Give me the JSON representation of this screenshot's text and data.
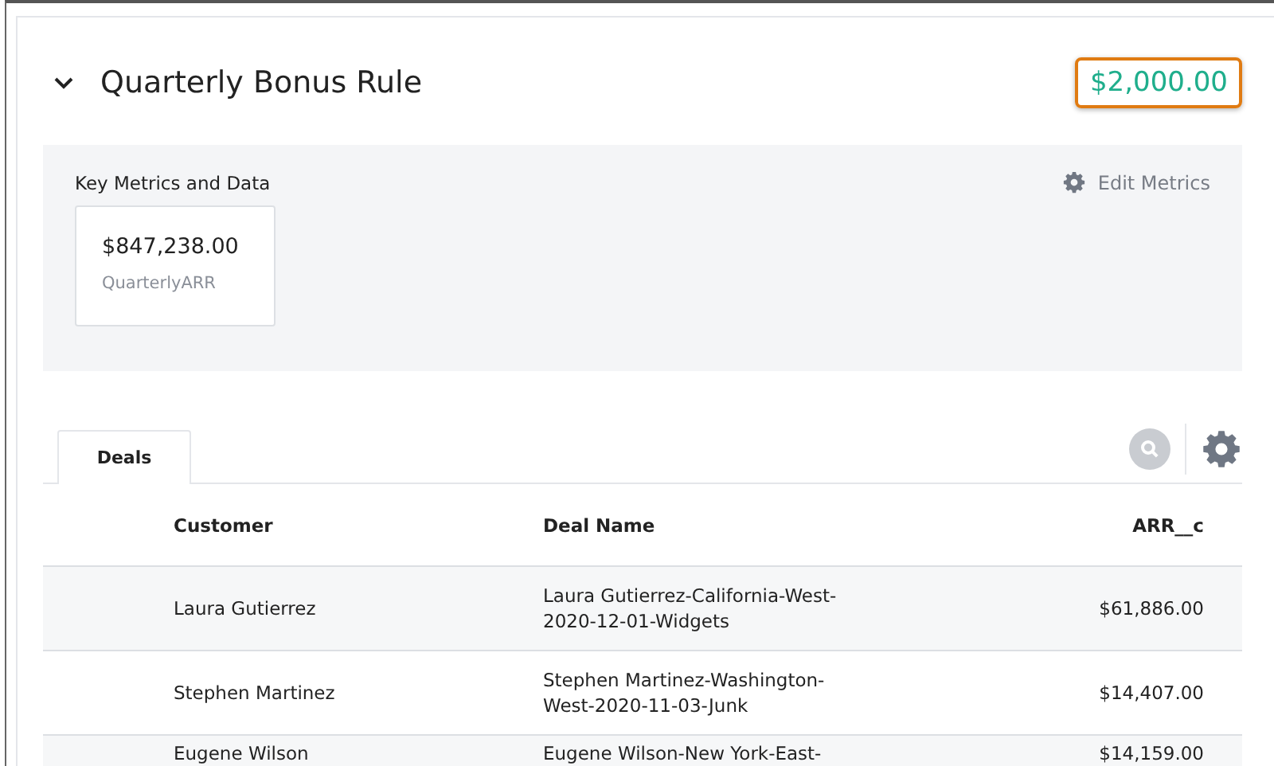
{
  "rule": {
    "title": "Quarterly Bonus Rule",
    "amount": "$2,000.00",
    "expanded": true
  },
  "metrics": {
    "title": "Key Metrics and Data",
    "edit_label": "Edit Metrics",
    "cards": [
      {
        "value": "$847,238.00",
        "label": "QuarterlyARR"
      }
    ]
  },
  "tabs": [
    {
      "label": "Deals",
      "selected": true
    }
  ],
  "table": {
    "columns": [
      "Customer",
      "Deal Name",
      "ARR__c"
    ],
    "rows": [
      {
        "customer": "Laura Gutierrez",
        "deal_name": [
          "Laura Gutierrez-California-West-",
          "2020-12-01-Widgets"
        ],
        "arr": "$61,886.00"
      },
      {
        "customer": "Stephen Martinez",
        "deal_name": [
          "Stephen Martinez-Washington-",
          "West-2020-11-03-Junk"
        ],
        "arr": "$14,407.00"
      },
      {
        "customer": "Eugene Wilson",
        "deal_name": [
          "Eugene Wilson-New York-East-"
        ],
        "arr": "$14,159.00"
      }
    ]
  }
}
